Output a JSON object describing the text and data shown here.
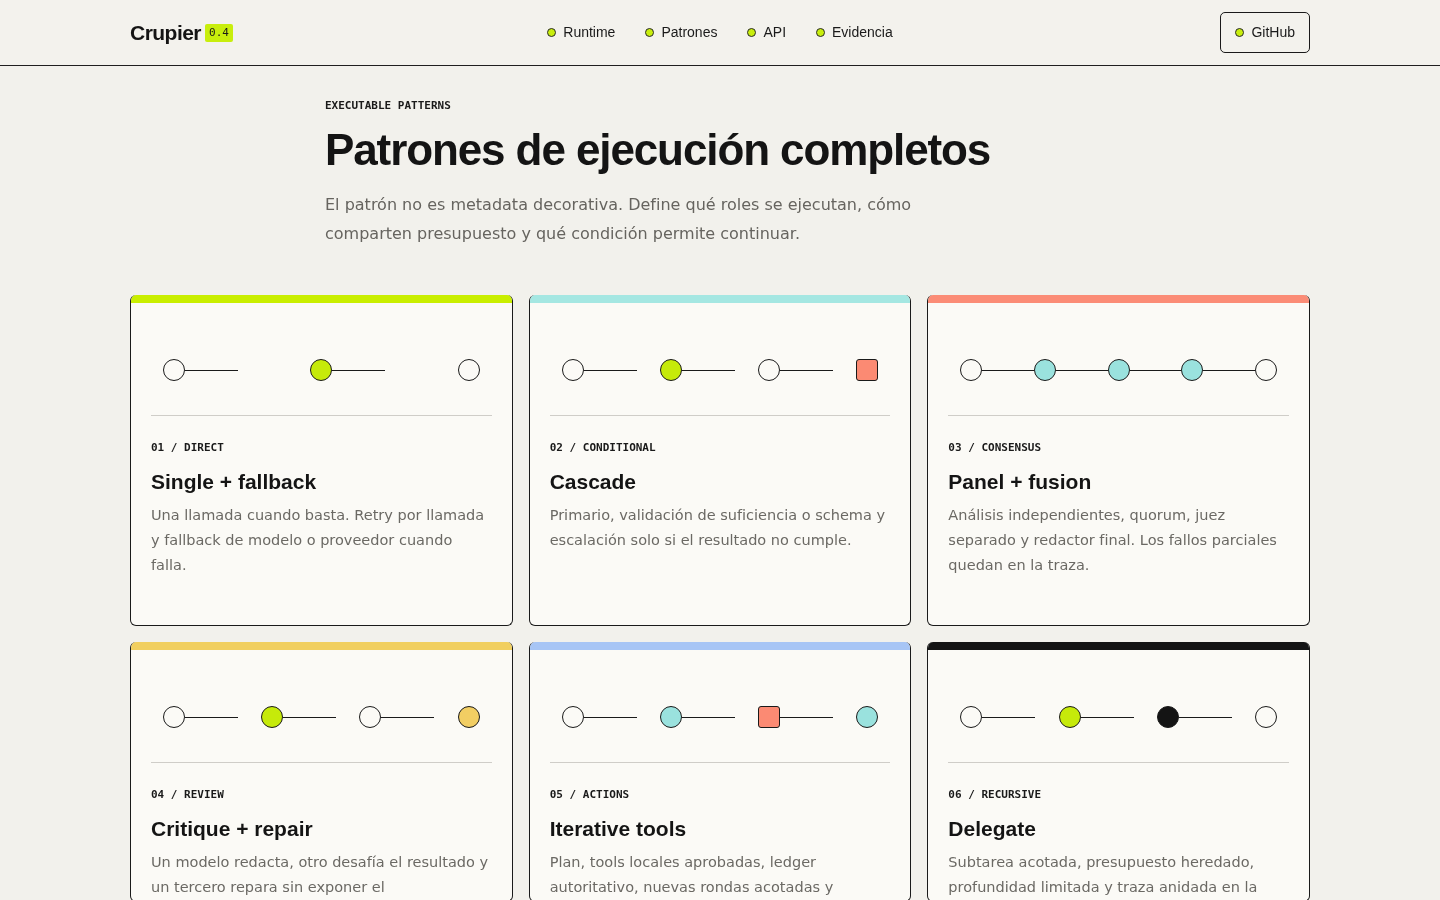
{
  "header": {
    "logo": "Crupier",
    "version": "0.4",
    "nav": [
      "Runtime",
      "Patrones",
      "API",
      "Evidencia"
    ],
    "github": "GitHub"
  },
  "hero": {
    "eyebrow": "EXECUTABLE PATTERNS",
    "title": "Patrones de ejecución completos",
    "description": "El patrón no es metadata decorativa. Define qué roles se ejecutan, cómo comparten presupuesto y qué condición permite continuar."
  },
  "patterns": [
    {
      "color": "#c9ee00",
      "label": "01 / DIRECT",
      "title": "Single + fallback",
      "description": "Una llamada cuando basta. Retry por llamada y fallback de modelo o proveedor cuando falla.",
      "nodes": [
        {
          "kind": "circle"
        },
        {
          "kind": "circle",
          "color": "#c6ea0a"
        },
        {
          "kind": "circle"
        }
      ]
    },
    {
      "color": "#a5e7e2",
      "label": "02 / CONDITIONAL",
      "title": "Cascade",
      "description": "Primario, validación de suficiencia o schema y escalación solo si el resultado no cumple.",
      "nodes": [
        {
          "kind": "circle"
        },
        {
          "kind": "circle",
          "color": "#c6ea0a"
        },
        {
          "kind": "circle"
        },
        {
          "kind": "square",
          "color": "#fb8a73"
        }
      ]
    },
    {
      "color": "#fb8c76",
      "label": "03 / CONSENSUS",
      "title": "Panel + fusion",
      "description": "Análisis independientes, quorum, juez separado y redactor final. Los fallos parciales quedan en la traza.",
      "nodes": [
        {
          "kind": "circle"
        },
        {
          "kind": "circle",
          "color": "#9ae2de"
        },
        {
          "kind": "circle",
          "color": "#9ae2de"
        },
        {
          "kind": "circle",
          "color": "#9ae2de"
        },
        {
          "kind": "circle"
        }
      ]
    },
    {
      "color": "#f1cf5f",
      "label": "04 / REVIEW",
      "title": "Critique + repair",
      "description": "Un modelo redacta, otro desafía el resultado y un tercero repara sin exponer el",
      "nodes": [
        {
          "kind": "circle"
        },
        {
          "kind": "circle",
          "color": "#c6ea0a"
        },
        {
          "kind": "circle"
        },
        {
          "kind": "circle",
          "color": "#f2ce63"
        }
      ]
    },
    {
      "color": "#a7c5f5",
      "label": "05 / ACTIONS",
      "title": "Iterative tools",
      "description": "Plan, tools locales aprobadas, ledger autoritativo, nuevas rondas acotadas y",
      "nodes": [
        {
          "kind": "circle"
        },
        {
          "kind": "circle",
          "color": "#9ae2de"
        },
        {
          "kind": "square",
          "color": "#fb8a73"
        },
        {
          "kind": "circle",
          "color": "#9ae2de"
        }
      ]
    },
    {
      "color": "#141414",
      "label": "06 / RECURSIVE",
      "title": "Delegate",
      "description": "Subtarea acotada, presupuesto heredado, profundidad limitada y traza anidada en la",
      "nodes": [
        {
          "kind": "circle"
        },
        {
          "kind": "circle",
          "color": "#c6ea0a"
        },
        {
          "kind": "circle",
          "color": "#141414"
        },
        {
          "kind": "circle"
        }
      ]
    }
  ]
}
